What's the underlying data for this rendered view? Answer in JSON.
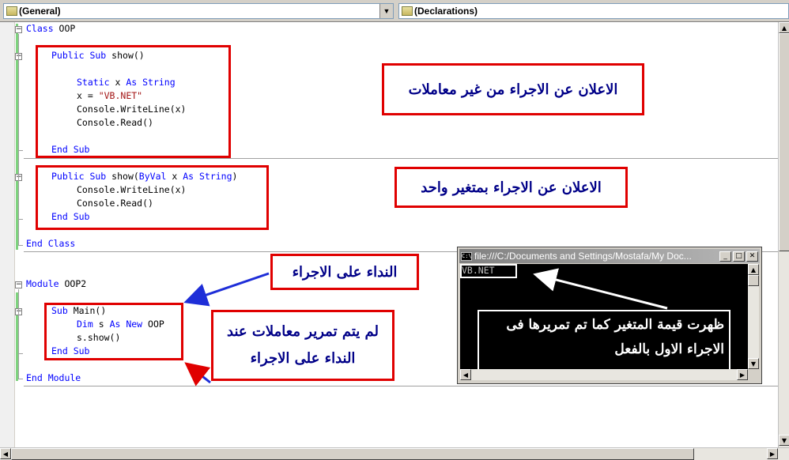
{
  "toolbar": {
    "left_combo": "(General)",
    "right_combo": "(Declarations)"
  },
  "code": {
    "class_open": [
      "Class",
      " OOP"
    ],
    "sub1_decl": [
      "Public Sub",
      " show()"
    ],
    "static_line": [
      "Static",
      " x ",
      "As String"
    ],
    "assign_line": [
      "x = ",
      "\"VB.NET\""
    ],
    "writeline_x": "Console.WriteLine(x)",
    "read": "Console.Read()",
    "end_sub": "End Sub",
    "sub2_decl": [
      "Public Sub",
      " show(",
      "ByVal",
      " x ",
      "As String",
      ")"
    ],
    "end_class": "End Class",
    "module_open": [
      "Module",
      " OOP2"
    ],
    "sub_main": [
      "Sub",
      " Main()"
    ],
    "dim_line": [
      "Dim",
      " s ",
      "As New",
      " OOP"
    ],
    "call_line": "s.show()",
    "end_module": "End Module"
  },
  "notes": {
    "note1": "الاعلان عن الاجراء من غير معاملات",
    "note2": "الاعلان عن الاجراء بمتغير واحد",
    "note3": "النداء على الاجراء",
    "note4_line1": "لم يتم تمرير معاملات عند",
    "note4_line2": "النداء على الاجراء"
  },
  "console": {
    "title": "file:///C:/Documents and Settings/Mostafa/My Doc...",
    "output": "VB.NET",
    "note_line1": "ظهرت قيمة المتغير كما تم تمريرها فى",
    "note_line2": "الاجراء الاول بالفعل",
    "icon_label": "C:\\"
  },
  "colors": {
    "keyword": "#0000ff",
    "string": "#a31515",
    "highlight_box": "#e00000",
    "arrow_blue": "#1e2ed8",
    "arrow_red": "#e00000",
    "note_text": "#000088"
  }
}
